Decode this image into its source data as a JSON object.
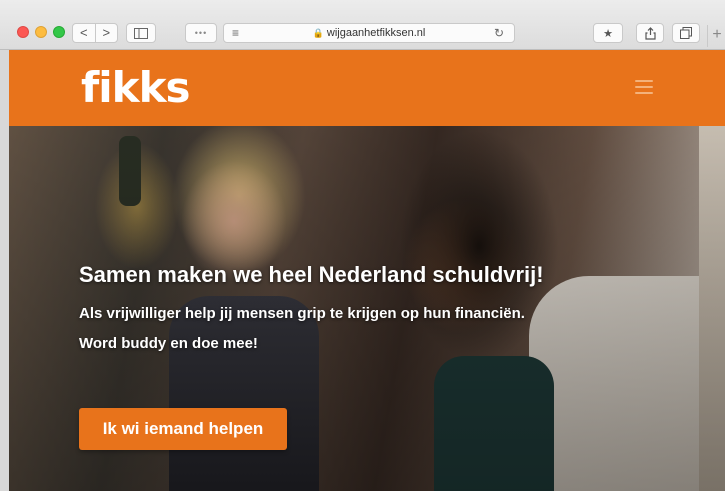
{
  "browser": {
    "url": "wijgaanhetfikksen.nl",
    "lock_icon": "lock-icon",
    "reader_icon": "reader-icon",
    "reload_icon": "reload-icon",
    "back_label": "<",
    "forward_label": ">",
    "dots_label": "•••",
    "plus_label": "+"
  },
  "site": {
    "logo": "fikks",
    "brand_color": "#e8731b",
    "menu_icon": "hamburger-icon"
  },
  "hero": {
    "headline": "Samen maken we heel Nederland schuldvrij!",
    "subline_1": "Als vrijwilliger help jij mensen grip te krijgen op hun financiën.",
    "subline_2": "Word buddy en doe mee!",
    "cta_label": "Ik wi iemand helpen"
  }
}
